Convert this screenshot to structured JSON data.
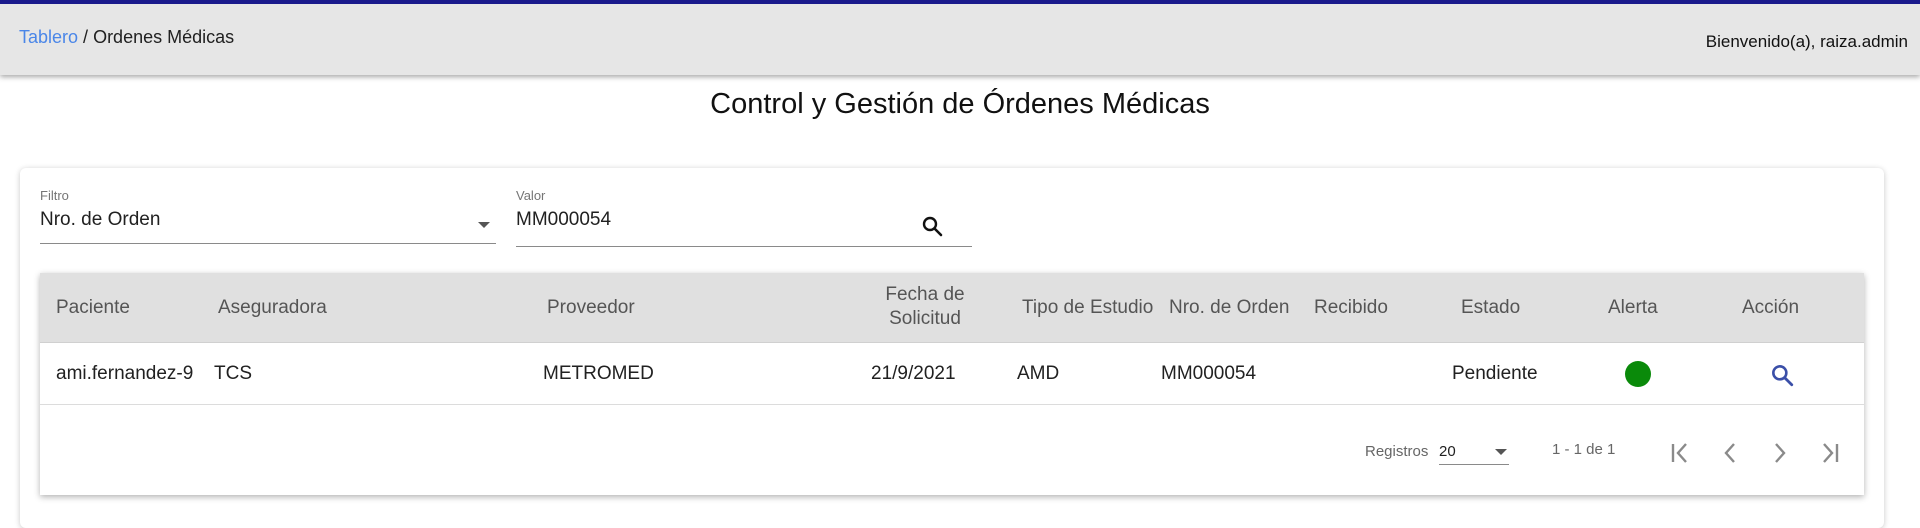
{
  "header": {
    "breadcrumb_link": "Tablero",
    "breadcrumb_sep": " / ",
    "breadcrumb_current": "Ordenes Médicas",
    "welcome": "Bienvenido(a), raiza.admin",
    "accent_color": "#1a1a8c"
  },
  "page": {
    "title": "Control y Gestión de Órdenes Médicas"
  },
  "filters": {
    "filter_label": "Filtro",
    "filter_value": "Nro. de Orden",
    "value_label": "Valor",
    "value_value": "MM000054"
  },
  "table": {
    "headers": {
      "paciente": "Paciente",
      "aseguradora": "Aseguradora",
      "proveedor": "Proveedor",
      "fecha_line1": "Fecha de",
      "fecha_line2": "Solicitud",
      "tipo": "Tipo de Estudio",
      "nro": "Nro. de Orden",
      "recibido": "Recibido",
      "estado": "Estado",
      "alerta": "Alerta",
      "accion": "Acción"
    },
    "rows": [
      {
        "paciente": "ami.fernandez-9",
        "aseguradora": "TCS",
        "proveedor": "METROMED",
        "fecha": "21/9/2021",
        "tipo": "AMD",
        "nro": "MM000054",
        "recibido": "",
        "estado": "Pendiente",
        "alerta_color": "#0a8a0a"
      }
    ]
  },
  "pagination": {
    "label": "Registros",
    "page_size": "20",
    "range": "1 - 1 de 1"
  }
}
